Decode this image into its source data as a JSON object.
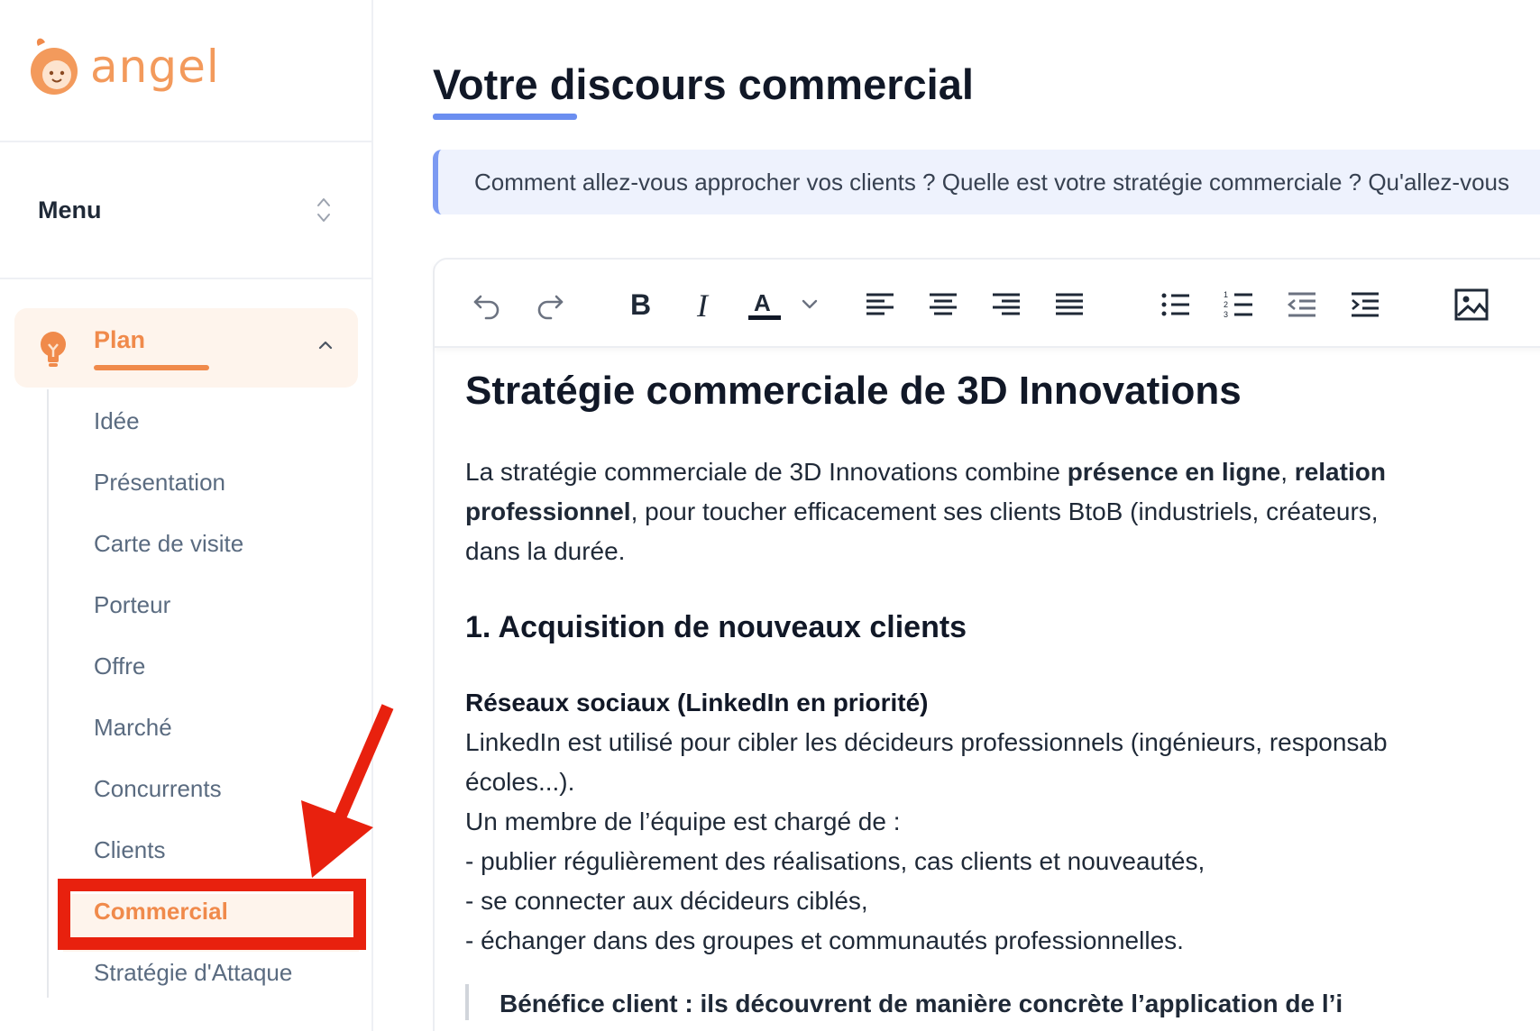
{
  "brand": {
    "name": "angel",
    "accent": "#f08a4b"
  },
  "sidebar": {
    "menu_label": "Menu",
    "plan_label": "Plan",
    "items": [
      {
        "label": "Idée"
      },
      {
        "label": "Présentation"
      },
      {
        "label": "Carte de visite"
      },
      {
        "label": "Porteur"
      },
      {
        "label": "Offre"
      },
      {
        "label": "Marché"
      },
      {
        "label": "Concurrents"
      },
      {
        "label": "Clients"
      },
      {
        "label": "Commercial",
        "active": true
      },
      {
        "label": "Stratégie d'Attaque"
      }
    ]
  },
  "main": {
    "title": "Votre discours commercial",
    "hint": "Comment allez-vous approcher vos clients ? Quelle est votre stratégie commerciale ? Qu'allez-vous"
  },
  "toolbar": {
    "buttons": [
      "undo-icon",
      "redo-icon",
      "bold-icon",
      "italic-icon",
      "text-color-icon",
      "chevron-down-icon",
      "align-left-icon",
      "align-center-icon",
      "align-right-icon",
      "align-justify-icon",
      "bullet-list-icon",
      "numbered-list-icon",
      "outdent-icon",
      "indent-icon",
      "image-icon"
    ]
  },
  "document": {
    "h1": "Stratégie commerciale de 3D Innovations",
    "intro_1": "La stratégie commerciale de 3D Innovations combine ",
    "intro_b1": "présence en ligne",
    "intro_2": ", ",
    "intro_b2": "relation",
    "intro_b3": "professionnel",
    "intro_3": ", pour toucher efficacement ses clients BtoB (industriels, créateurs,",
    "intro_4": "dans la durée.",
    "h2": "1. Acquisition de nouveaux clients",
    "subheading": "Réseaux sociaux (LinkedIn en priorité)",
    "lines": [
      "LinkedIn est utilisé pour cibler les décideurs professionnels (ingénieurs, responsab",
      "écoles...).",
      "Un membre de l’équipe est chargé de :",
      "- publier régulièrement des réalisations, cas clients et nouveautés,",
      "- se connecter aux décideurs ciblés,",
      "- échanger dans des groupes et communautés professionnelles."
    ],
    "quote": "Bénéfice client : ils découvrent de manière concrète l’application de l’i"
  }
}
